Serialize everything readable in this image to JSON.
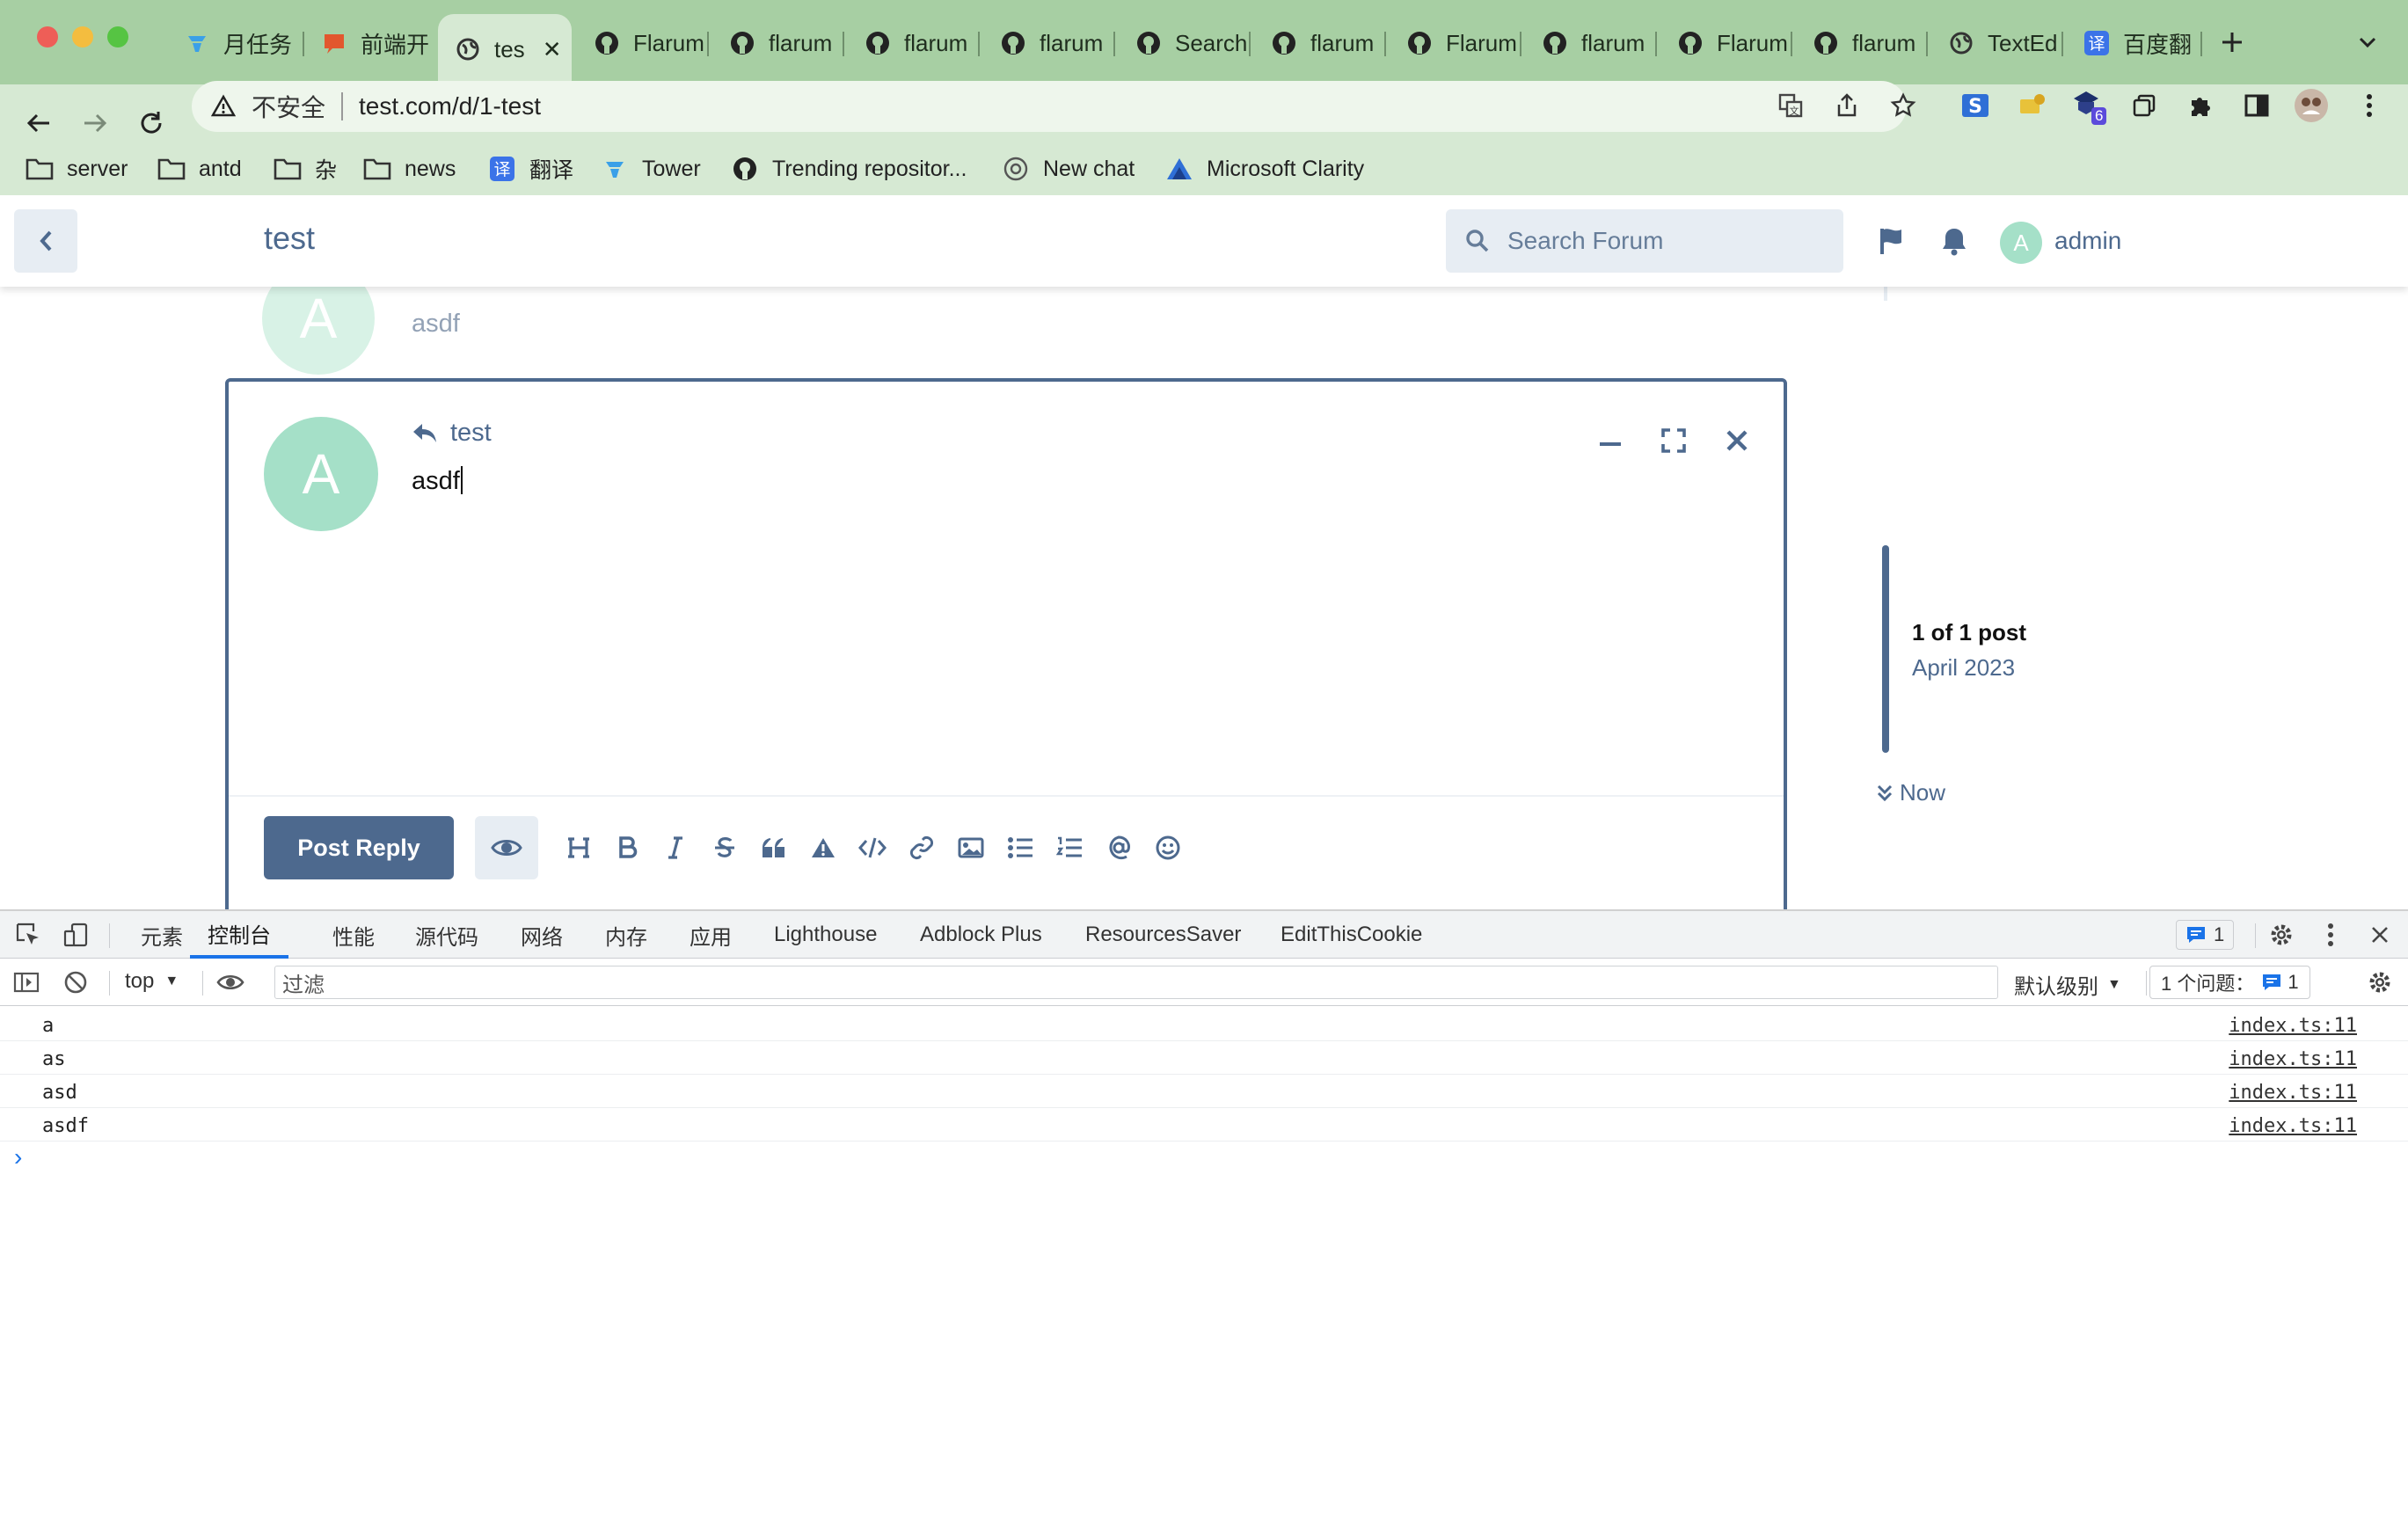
{
  "browser": {
    "tabs": [
      {
        "title": "月任务",
        "icon": "tower-icon"
      },
      {
        "title": "前端开",
        "icon": "slides-icon"
      },
      {
        "title": "tes",
        "icon": "globe-icon",
        "active": true
      },
      {
        "title": "Flarum",
        "icon": "github-icon"
      },
      {
        "title": "flarum",
        "icon": "github-icon"
      },
      {
        "title": "flarum",
        "icon": "github-icon"
      },
      {
        "title": "flarum",
        "icon": "github-icon"
      },
      {
        "title": "Search",
        "icon": "github-icon"
      },
      {
        "title": "flarum",
        "icon": "github-icon"
      },
      {
        "title": "Flarum",
        "icon": "github-icon"
      },
      {
        "title": "flarum",
        "icon": "github-icon"
      },
      {
        "title": "Flarum",
        "icon": "github-icon"
      },
      {
        "title": "flarum",
        "icon": "github-icon"
      },
      {
        "title": "TextEd",
        "icon": "globe-icon"
      },
      {
        "title": "百度翻",
        "icon": "translate-icon"
      }
    ],
    "security_label": "不安全",
    "url": "test.com/d/1-test",
    "extension_badge": "6",
    "bookmarks": [
      {
        "label": "server",
        "icon": "folder-icon"
      },
      {
        "label": "antd",
        "icon": "folder-icon"
      },
      {
        "label": "杂",
        "icon": "folder-icon"
      },
      {
        "label": "news",
        "icon": "folder-icon"
      },
      {
        "label": "翻译",
        "icon": "translate-icon"
      },
      {
        "label": "Tower",
        "icon": "tower-icon"
      },
      {
        "label": "Trending repositor...",
        "icon": "github-icon"
      },
      {
        "label": "New chat",
        "icon": "openai-icon"
      },
      {
        "label": "Microsoft Clarity",
        "icon": "clarity-icon"
      }
    ]
  },
  "forum": {
    "title": "test",
    "search_placeholder": "Search Forum",
    "username": "admin",
    "avatar_letter": "A",
    "prev_post_text": "asdf",
    "composer": {
      "reply_to": "test",
      "content": "asdf",
      "post_reply_label": "Post Reply"
    },
    "scrubber": {
      "count": "1 of 1 post",
      "date": "April 2023",
      "now": "Now"
    }
  },
  "devtools": {
    "tabs": [
      "元素",
      "控制台",
      "性能",
      "源代码",
      "网络",
      "内存",
      "应用",
      "Lighthouse",
      "Adblock Plus",
      "ResourcesSaver",
      "EditThisCookie"
    ],
    "active_tab": "控制台",
    "issues_badge_count": "1",
    "context": "top",
    "filter_placeholder": "过滤",
    "level": "默认级别",
    "issues_label": "1 个问题：",
    "issues_count": "1",
    "logs": [
      {
        "message": "a",
        "source": "index.ts:11"
      },
      {
        "message": "as",
        "source": "index.ts:11"
      },
      {
        "message": "asd",
        "source": "index.ts:11"
      },
      {
        "message": "asdf",
        "source": "index.ts:11"
      }
    ],
    "prompt": "›"
  },
  "colors": {
    "chrome_bg": "#a7cfa3",
    "toolbar_bg": "#d6e9d3",
    "forum_primary": "#4d698e",
    "avatar": "#a5e0c8",
    "devtools_accent": "#1a73e8"
  }
}
